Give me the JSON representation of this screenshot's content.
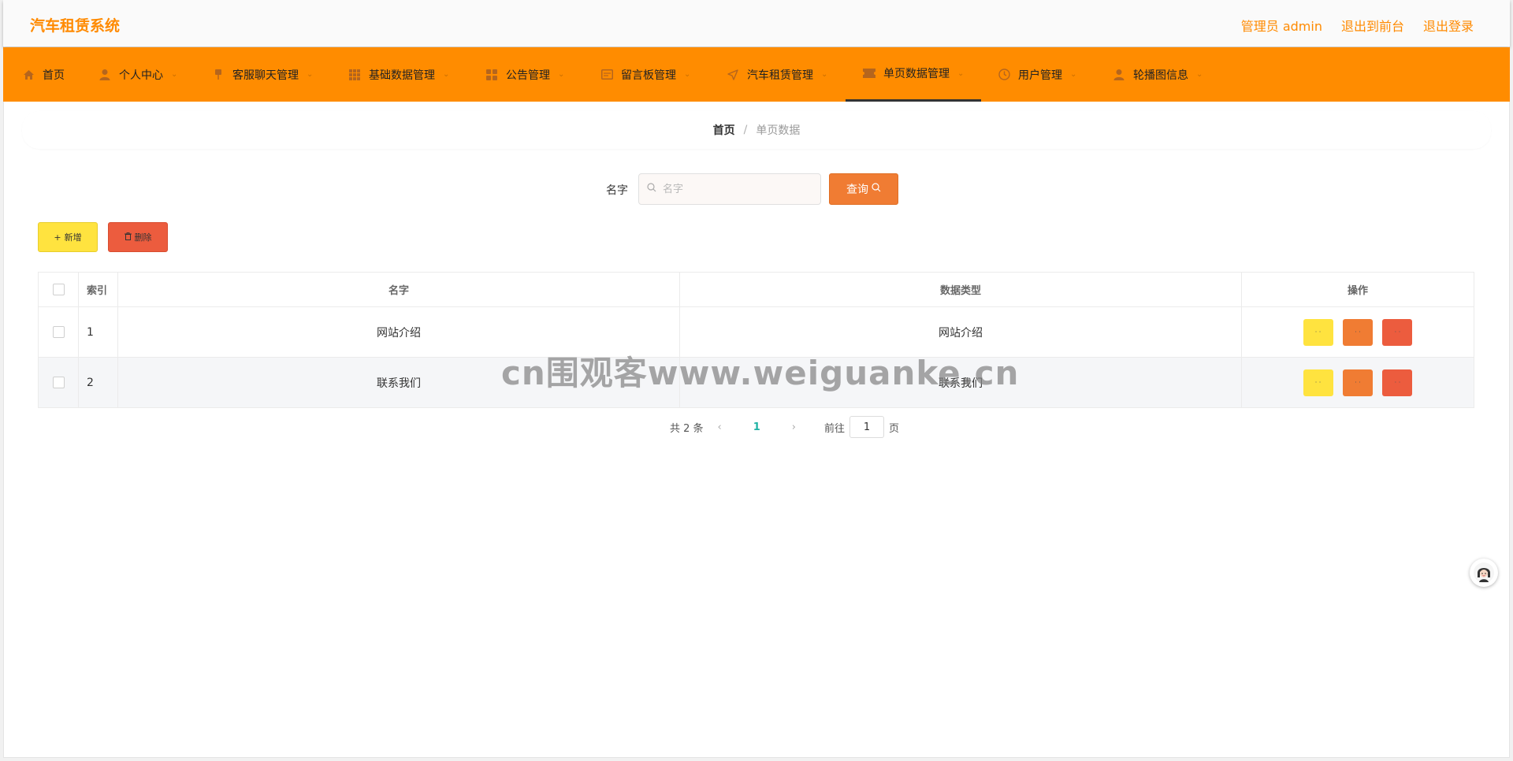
{
  "header": {
    "title": "汽车租赁系统",
    "links": [
      "管理员 admin",
      "退出到前台",
      "退出登录"
    ]
  },
  "nav": {
    "items": [
      {
        "label": "首页",
        "icon": "home-icon",
        "chevron": false
      },
      {
        "label": "个人中心",
        "icon": "user-icon",
        "chevron": true
      },
      {
        "label": "客服聊天管理",
        "icon": "pin-icon",
        "chevron": true
      },
      {
        "label": "基础数据管理",
        "icon": "grid-icon",
        "chevron": true
      },
      {
        "label": "公告管理",
        "icon": "apps-icon",
        "chevron": true
      },
      {
        "label": "留言板管理",
        "icon": "message-icon",
        "chevron": true
      },
      {
        "label": "汽车租赁管理",
        "icon": "send-icon",
        "chevron": true
      },
      {
        "label": "单页数据管理",
        "icon": "ticket-icon",
        "chevron": true,
        "active": true
      },
      {
        "label": "用户管理",
        "icon": "clock-icon",
        "chevron": true
      },
      {
        "label": "轮播图信息",
        "icon": "user-icon",
        "chevron": true
      }
    ]
  },
  "breadcrumb": {
    "home": "首页",
    "separator": "/",
    "current": "单页数据"
  },
  "search": {
    "label": "名字",
    "placeholder": "名字",
    "value": "",
    "button": "查询"
  },
  "actions": {
    "add": "新增",
    "delete": "删除"
  },
  "table": {
    "headers": [
      "索引",
      "名字",
      "数据类型",
      "操作"
    ],
    "rows": [
      {
        "index": "1",
        "name": "网站介绍",
        "type": "网站介绍"
      },
      {
        "index": "2",
        "name": "联系我们",
        "type": "联系我们"
      }
    ]
  },
  "pagination": {
    "total": "共 2 条",
    "current_page": "1",
    "goto_label": "前往",
    "goto_value": "1",
    "page_suffix": "页"
  },
  "watermark": "cn围观客www.weiguanke.cn",
  "colors": {
    "brand": "#ff8a00",
    "nav_bg": "#ff8c00",
    "btn_yellow": "#ffe33f",
    "btn_orange": "#f07c33",
    "btn_red": "#ec5c3e",
    "page_active": "#20b2a4"
  }
}
